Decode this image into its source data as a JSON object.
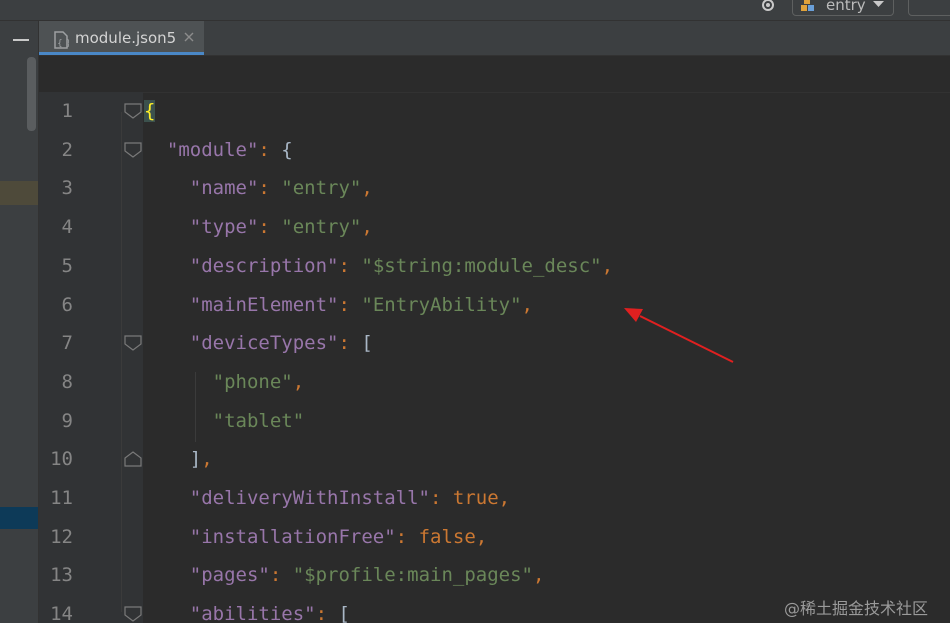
{
  "toolbar": {
    "run_config_label": "entry"
  },
  "tab": {
    "label": "module.json5"
  },
  "editor": {
    "lines": [
      {
        "no": "1",
        "tokens": [
          {
            "t": "{",
            "c": "br-hl"
          }
        ]
      },
      {
        "no": "2",
        "tokens": [
          {
            "t": "  ",
            "c": ""
          },
          {
            "t": "\"module\"",
            "c": "key"
          },
          {
            "t": ": ",
            "c": "punct"
          },
          {
            "t": "{",
            "c": "br"
          }
        ]
      },
      {
        "no": "3",
        "tokens": [
          {
            "t": "    ",
            "c": ""
          },
          {
            "t": "\"name\"",
            "c": "key"
          },
          {
            "t": ": ",
            "c": "punct"
          },
          {
            "t": "\"entry\"",
            "c": "str"
          },
          {
            "t": ",",
            "c": "punct"
          }
        ]
      },
      {
        "no": "4",
        "tokens": [
          {
            "t": "    ",
            "c": ""
          },
          {
            "t": "\"type\"",
            "c": "key"
          },
          {
            "t": ": ",
            "c": "punct"
          },
          {
            "t": "\"entry\"",
            "c": "str"
          },
          {
            "t": ",",
            "c": "punct"
          }
        ]
      },
      {
        "no": "5",
        "tokens": [
          {
            "t": "    ",
            "c": ""
          },
          {
            "t": "\"description\"",
            "c": "key"
          },
          {
            "t": ": ",
            "c": "punct"
          },
          {
            "t": "\"$string:module_desc\"",
            "c": "str"
          },
          {
            "t": ",",
            "c": "punct"
          }
        ]
      },
      {
        "no": "6",
        "tokens": [
          {
            "t": "    ",
            "c": ""
          },
          {
            "t": "\"mainElement\"",
            "c": "key"
          },
          {
            "t": ": ",
            "c": "punct"
          },
          {
            "t": "\"EntryAbility\"",
            "c": "str"
          },
          {
            "t": ",",
            "c": "punct"
          }
        ]
      },
      {
        "no": "7",
        "tokens": [
          {
            "t": "    ",
            "c": ""
          },
          {
            "t": "\"deviceTypes\"",
            "c": "key"
          },
          {
            "t": ": ",
            "c": "punct"
          },
          {
            "t": "[",
            "c": "br"
          }
        ]
      },
      {
        "no": "8",
        "tokens": [
          {
            "t": "      ",
            "c": ""
          },
          {
            "t": "\"phone\"",
            "c": "str"
          },
          {
            "t": ",",
            "c": "punct"
          }
        ]
      },
      {
        "no": "9",
        "tokens": [
          {
            "t": "      ",
            "c": ""
          },
          {
            "t": "\"tablet\"",
            "c": "str"
          }
        ]
      },
      {
        "no": "10",
        "tokens": [
          {
            "t": "    ",
            "c": ""
          },
          {
            "t": "]",
            "c": "br"
          },
          {
            "t": ",",
            "c": "punct"
          }
        ]
      },
      {
        "no": "11",
        "tokens": [
          {
            "t": "    ",
            "c": ""
          },
          {
            "t": "\"deliveryWithInstall\"",
            "c": "key"
          },
          {
            "t": ": ",
            "c": "punct"
          },
          {
            "t": "true",
            "c": "bool"
          },
          {
            "t": ",",
            "c": "punct"
          }
        ]
      },
      {
        "no": "12",
        "tokens": [
          {
            "t": "    ",
            "c": ""
          },
          {
            "t": "\"installationFree\"",
            "c": "key"
          },
          {
            "t": ": ",
            "c": "punct"
          },
          {
            "t": "false",
            "c": "bool"
          },
          {
            "t": ",",
            "c": "punct"
          }
        ]
      },
      {
        "no": "13",
        "tokens": [
          {
            "t": "    ",
            "c": ""
          },
          {
            "t": "\"pages\"",
            "c": "key"
          },
          {
            "t": ": ",
            "c": "punct"
          },
          {
            "t": "\"$profile:main_pages\"",
            "c": "str"
          },
          {
            "t": ",",
            "c": "punct"
          }
        ]
      },
      {
        "no": "14",
        "tokens": [
          {
            "t": "    ",
            "c": ""
          },
          {
            "t": "\"abilities\"",
            "c": "key"
          },
          {
            "t": ": ",
            "c": "punct"
          },
          {
            "t": "[",
            "c": "br"
          }
        ]
      }
    ]
  },
  "watermark": "@稀土掘金技术社区",
  "colors": {
    "annotation_arrow": "#e02020",
    "active_tab_underline": "#4a88c7"
  }
}
